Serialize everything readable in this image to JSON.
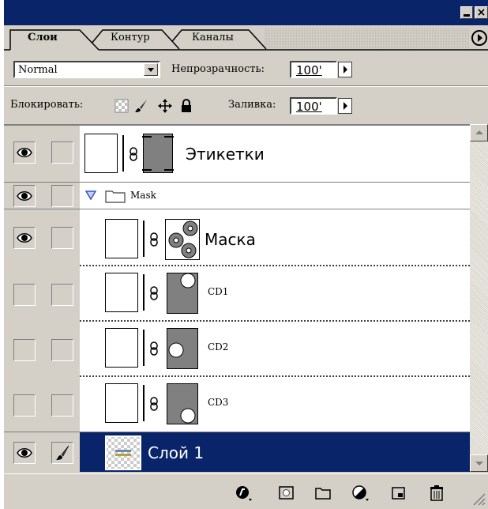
{
  "tabs": {
    "layers": "Слои",
    "paths": "Контур",
    "channels": "Каналы"
  },
  "options": {
    "blend_mode": "Normal",
    "opacity_label": "Непрозрачность:",
    "opacity_value": "100'",
    "lock_label": "Блокировать:",
    "fill_label": "Заливка:",
    "fill_value": "100'"
  },
  "layers": [
    {
      "name": "Этикетки",
      "visible": true,
      "kind": "layer-with-mask"
    },
    {
      "name": "Mask",
      "visible": true,
      "kind": "group",
      "expanded": true
    },
    {
      "name": "Маска",
      "visible": true,
      "kind": "layer-with-mask"
    },
    {
      "name": "CD1",
      "visible": false,
      "kind": "layer-with-mask"
    },
    {
      "name": "CD2",
      "visible": false,
      "kind": "layer-with-mask"
    },
    {
      "name": "CD3",
      "visible": false,
      "kind": "layer-with-mask"
    },
    {
      "name": "Слой 1",
      "visible": true,
      "kind": "layer",
      "selected": true
    }
  ],
  "colors": {
    "titlebar": "#0a246a",
    "selected_row": "#0a246a",
    "panel": "#d4d0c8",
    "group_arrow": "#3355cc"
  },
  "icons": {
    "bottom_toolbar": [
      "layer-style-icon",
      "add-mask-icon",
      "new-group-icon",
      "adjustment-layer-icon",
      "new-layer-icon",
      "trash-icon"
    ]
  }
}
